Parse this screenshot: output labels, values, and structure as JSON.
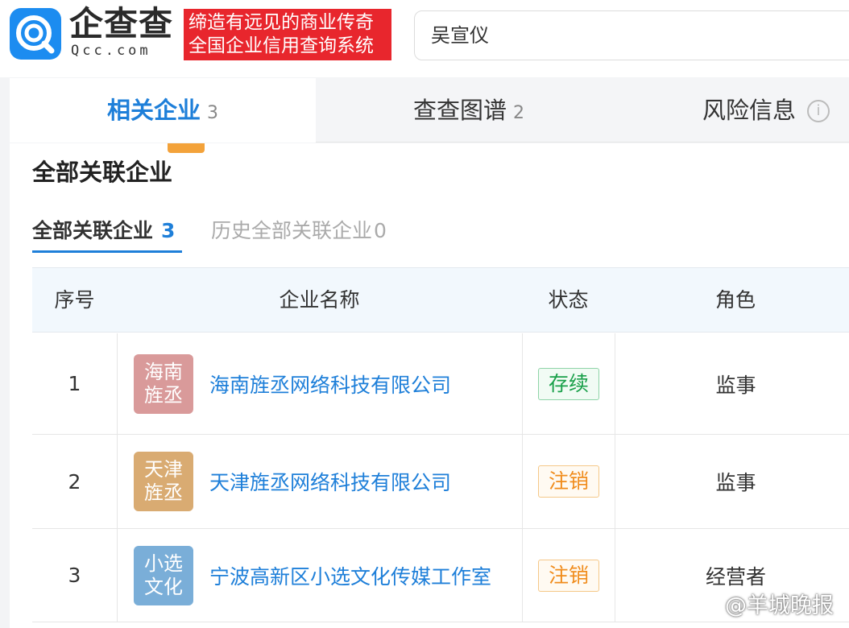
{
  "header": {
    "logo_text": "企查查",
    "logo_sub": "Qcc.com",
    "slogan_line1": "缔造有远见的商业传奇",
    "slogan_line2": "全国企业信用查询系统",
    "search_value": "吴宣仪",
    "brand_color": "#1c8cf0",
    "slogan_color": "#e8262d"
  },
  "tabs": [
    {
      "label": "相关企业",
      "count": "3"
    },
    {
      "label": "查查图谱",
      "count": "2"
    },
    {
      "label": "风险信息",
      "icon": "info-icon"
    }
  ],
  "section": {
    "title": "全部关联企业",
    "subtabs": [
      {
        "label": "全部关联企业",
        "count": "3"
      },
      {
        "label": "历史全部关联企业",
        "count": "0"
      }
    ]
  },
  "table": {
    "columns": [
      "序号",
      "企业名称",
      "状态",
      "角色"
    ],
    "rows": [
      {
        "index": "1",
        "avatar_line1": "海南",
        "avatar_line2": "旌丞",
        "avatar_color": "#d99a9a",
        "name": "海南旌丞网络科技有限公司",
        "status": "存续",
        "status_color": "#1aa04a",
        "role": "监事"
      },
      {
        "index": "2",
        "avatar_line1": "天津",
        "avatar_line2": "旌丞",
        "avatar_color": "#d9ab72",
        "name": "天津旌丞网络科技有限公司",
        "status": "注销",
        "status_color": "#f08c1c",
        "role": "监事"
      },
      {
        "index": "3",
        "avatar_line1": "小选",
        "avatar_line2": "文化",
        "avatar_color": "#7aaed8",
        "name": "宁波高新区小选文化传媒工作室",
        "status": "注销",
        "status_color": "#f08c1c",
        "role": "经营者"
      }
    ]
  },
  "watermark": "@羊城晚报"
}
